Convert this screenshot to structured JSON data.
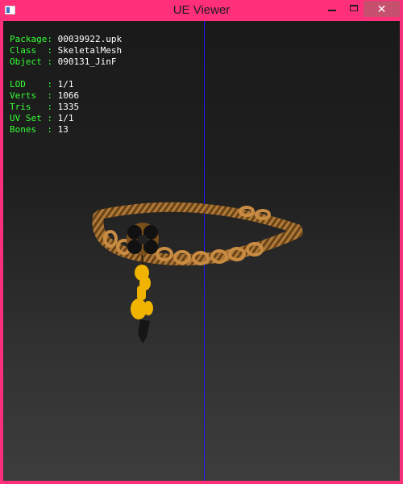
{
  "window": {
    "title": "UE Viewer",
    "close_glyph": "✕"
  },
  "info": {
    "package_label": "Package: ",
    "package_value": "00039922.upk",
    "class_label": "Class  : ",
    "class_value": "SkeletalMesh",
    "object_label": "Object : ",
    "object_value": "090131_JinF",
    "lod_label": "LOD    : ",
    "lod_value": "1/1",
    "verts_label": "Verts  : ",
    "verts_value": "1066",
    "tris_label": "Tris   : ",
    "tris_value": "1335",
    "uvset_label": "UV Set : ",
    "uvset_value": "1/1",
    "bones_label": "Bones  : ",
    "bones_value": "13"
  },
  "colors": {
    "window_frame": "#ff2f7a",
    "label_text": "#33ff33",
    "value_text": "#ffffff",
    "axis_line": "#1a1aff",
    "chain": "#b07a3a",
    "pendant": "#f0b400"
  },
  "icons": [
    "app-icon",
    "minimize-icon",
    "maximize-icon",
    "close-icon"
  ]
}
